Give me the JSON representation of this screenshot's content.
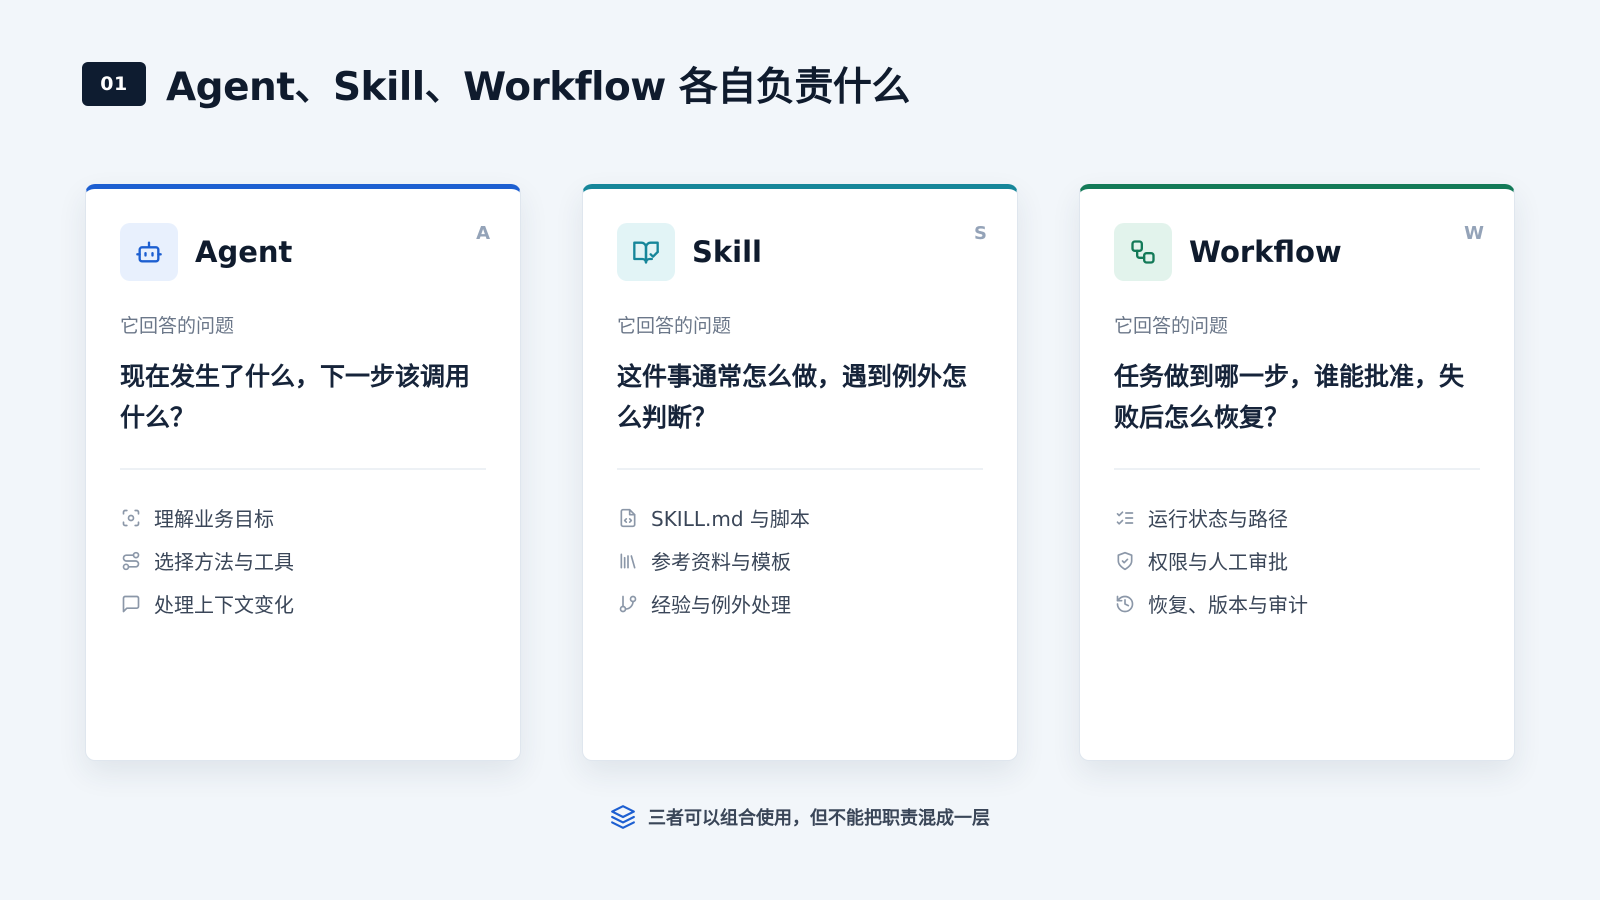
{
  "header": {
    "badge": "01",
    "title": "Agent、Skill、Workflow 各自负责什么"
  },
  "colors": {
    "agent_accent": "#1d5fd1",
    "skill_accent": "#16869a",
    "workflow_accent": "#137a58",
    "title_badge": "#0e1c30"
  },
  "cards": [
    {
      "title": "Agent",
      "corner": "A",
      "icon": "robot-icon",
      "question_label": "它回答的问题",
      "question": "现在发生了什么，下一步该调用什么？",
      "items": [
        {
          "icon": "scan-target-icon",
          "label": "理解业务目标"
        },
        {
          "icon": "route-icon",
          "label": "选择方法与工具"
        },
        {
          "icon": "message-square-icon",
          "label": "处理上下文变化"
        }
      ]
    },
    {
      "title": "Skill",
      "corner": "S",
      "icon": "book-check-icon",
      "question_label": "它回答的问题",
      "question": "这件事通常怎么做，遇到例外怎么判断？",
      "items": [
        {
          "icon": "file-code-icon",
          "label": "SKILL.md 与脚本"
        },
        {
          "icon": "library-icon",
          "label": "参考资料与模板"
        },
        {
          "icon": "git-branch-icon",
          "label": "经验与例外处理"
        }
      ]
    },
    {
      "title": "Workflow",
      "corner": "W",
      "icon": "workflow-icon",
      "question_label": "它回答的问题",
      "question": "任务做到哪一步，谁能批准，失败后怎么恢复？",
      "items": [
        {
          "icon": "list-checks-icon",
          "label": "运行状态与路径"
        },
        {
          "icon": "shield-check-icon",
          "label": "权限与人工审批"
        },
        {
          "icon": "history-icon",
          "label": "恢复、版本与审计"
        }
      ]
    }
  ],
  "footer": {
    "icon": "layers-icon",
    "text": "三者可以组合使用，但不能把职责混成一层"
  }
}
